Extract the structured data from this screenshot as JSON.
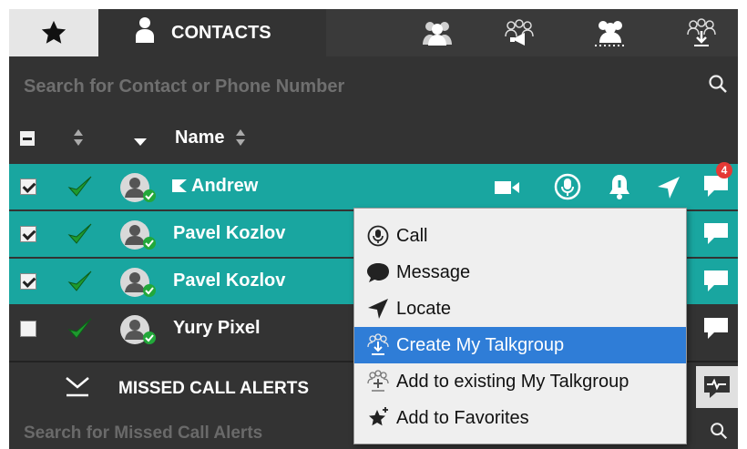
{
  "tabs": {
    "favorites_icon": "star-icon",
    "contacts_label": "CONTACTS",
    "contacts_icon": "person-icon",
    "other_icons": [
      "group-icon",
      "broadcast-group-icon",
      "dynamic-group-icon",
      "download-group-icon"
    ]
  },
  "search": {
    "placeholder": "Search for Contact or Phone Number",
    "icon": "search-icon"
  },
  "table": {
    "header": {
      "name_label": "Name"
    },
    "rows": [
      {
        "name": "Andrew",
        "selected": true,
        "checked": true,
        "status": "online",
        "emergency": true
      },
      {
        "name": "Pavel Kozlov",
        "selected": true,
        "checked": true,
        "status": "online"
      },
      {
        "name": "Pavel Kozlov",
        "selected": true,
        "checked": true,
        "status": "online"
      },
      {
        "name": "Yury Pixel",
        "selected": false,
        "checked": false,
        "status": "online"
      }
    ],
    "row_actions": [
      "video-icon",
      "call-icon",
      "alert-icon",
      "locate-icon",
      "message-icon"
    ],
    "unread_count": "4"
  },
  "context_menu": {
    "items": [
      {
        "label": "Call",
        "icon": "microphone-icon"
      },
      {
        "label": "Message",
        "icon": "speech-bubble-icon"
      },
      {
        "label": "Locate",
        "icon": "locate-arrow-icon"
      },
      {
        "label": "Create My Talkgroup",
        "icon": "create-talkgroup-icon",
        "highlighted": true
      },
      {
        "label": "Add to existing My Talkgroup",
        "icon": "add-talkgroup-icon"
      },
      {
        "label": "Add to Favorites",
        "icon": "add-star-icon"
      }
    ]
  },
  "missed_calls": {
    "title": "MISSED CALL ALERTS",
    "search_placeholder": "Search for Missed Call Alerts",
    "pulse_icon": "heartbeat-icon"
  },
  "colors": {
    "selected_row": "#19a6a0",
    "background": "#333333",
    "menu_highlight": "#2f7dd7",
    "badge": "#e53935"
  }
}
